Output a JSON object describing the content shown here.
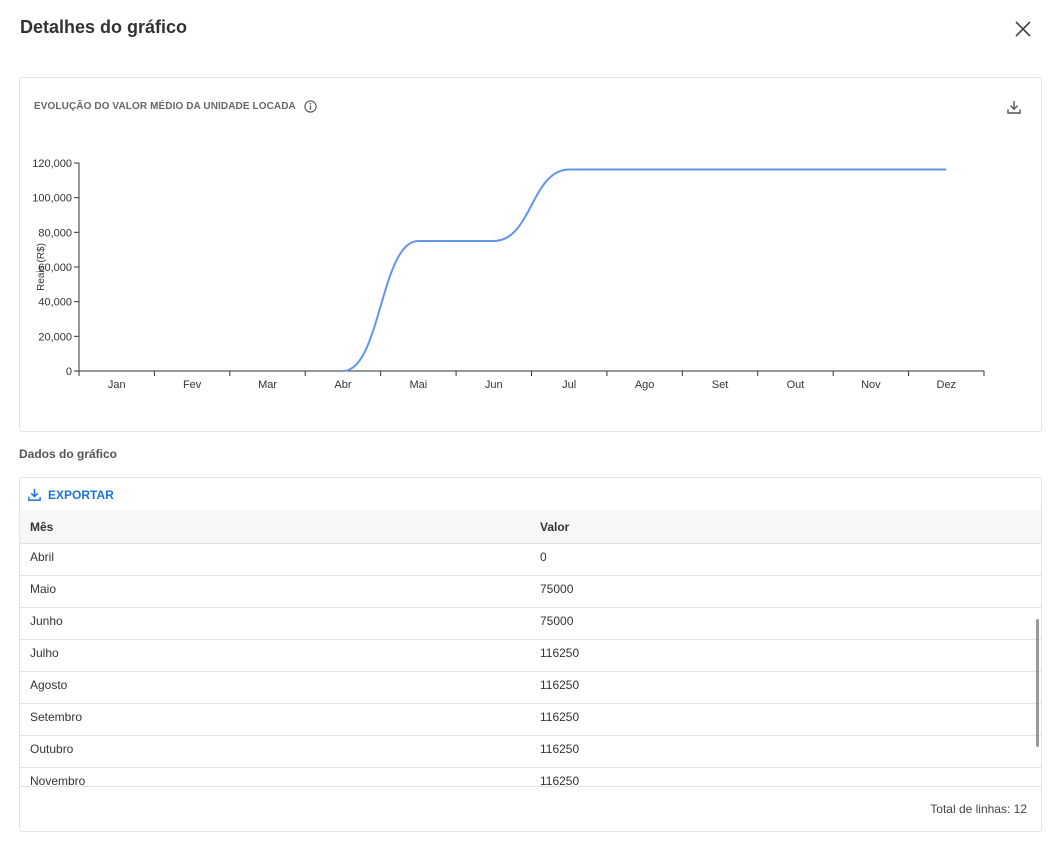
{
  "modal": {
    "title": "Detalhes do gráfico"
  },
  "chart_card": {
    "title": "EVOLUÇÃO DO VALOR MÉDIO DA UNIDADE LOCADA"
  },
  "chart_data": {
    "type": "line",
    "title": "EVOLUÇÃO DO VALOR MÉDIO DA UNIDADE LOCADA",
    "xlabel": "",
    "ylabel": "Reais (R$)",
    "categories": [
      "Jan",
      "Fev",
      "Mar",
      "Abr",
      "Mai",
      "Jun",
      "Jul",
      "Ago",
      "Set",
      "Out",
      "Nov",
      "Dez"
    ],
    "y_ticks": [
      "0",
      "20,000",
      "40,000",
      "60,000",
      "80,000",
      "100,000",
      "120,000"
    ],
    "ylim": [
      0,
      120000
    ],
    "series": [
      {
        "values": [
          null,
          null,
          null,
          0,
          75000,
          75000,
          116250,
          116250,
          116250,
          116250,
          116250,
          116250
        ]
      }
    ],
    "grid": false,
    "line_color": "#6495ed"
  },
  "table_section": {
    "label": "Dados do gráfico",
    "export_label": "EXPORTAR",
    "columns": [
      "Mês",
      "Valor"
    ],
    "rows": [
      [
        "Abril",
        "0"
      ],
      [
        "Maio",
        "75000"
      ],
      [
        "Junho",
        "75000"
      ],
      [
        "Julho",
        "116250"
      ],
      [
        "Agosto",
        "116250"
      ],
      [
        "Setembro",
        "116250"
      ],
      [
        "Outubro",
        "116250"
      ],
      [
        "Novembro",
        "116250"
      ]
    ],
    "total_label": "Total de linhas: 12"
  },
  "colors": {
    "accent": "#1e73d8",
    "line": "#6495ed"
  }
}
